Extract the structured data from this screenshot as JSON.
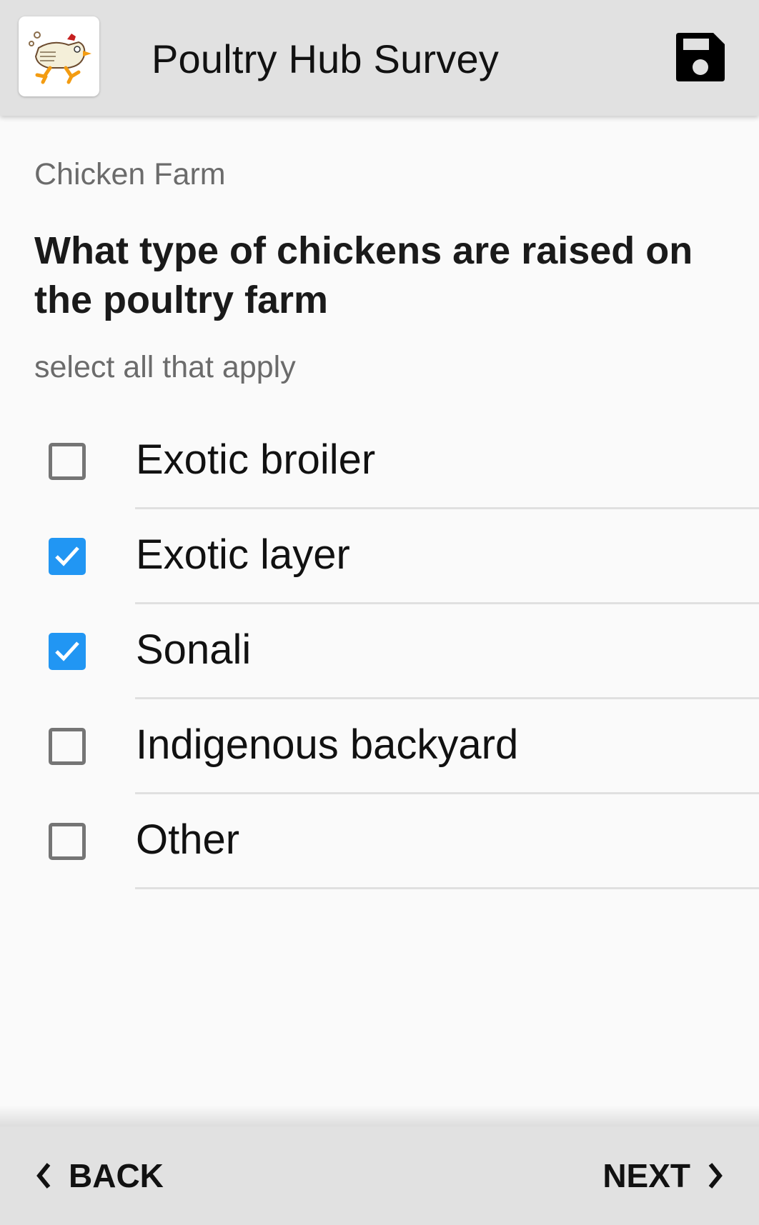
{
  "header": {
    "app_title": "Poultry Hub Survey",
    "logo_icon": "running-chicken-logo",
    "save_icon": "save-icon"
  },
  "form": {
    "group_label": "Chicken Farm",
    "question": "What type of chickens are raised on the poultry farm",
    "hint": "select all that apply",
    "options": [
      {
        "label": "Exotic broiler",
        "checked": false
      },
      {
        "label": "Exotic layer",
        "checked": true
      },
      {
        "label": "Sonali",
        "checked": true
      },
      {
        "label": "Indigenous backyard",
        "checked": false
      },
      {
        "label": "Other",
        "checked": false
      }
    ]
  },
  "footer": {
    "back_label": "BACK",
    "next_label": "NEXT"
  },
  "colors": {
    "accent": "#2196f3",
    "bar_bg": "#e1e1e1",
    "page_bg": "#fafafa"
  }
}
